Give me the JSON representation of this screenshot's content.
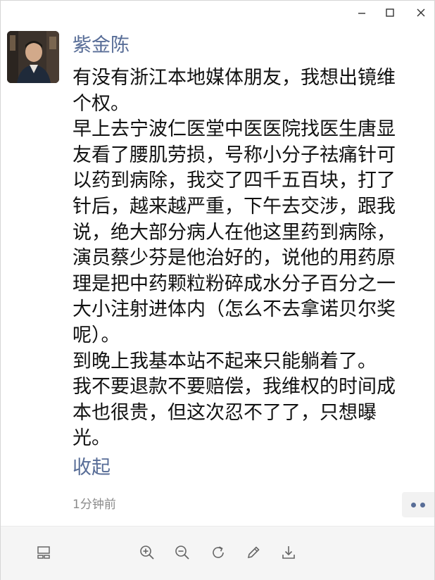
{
  "window": {
    "controls": [
      "minimize-icon",
      "maximize-icon",
      "close-icon"
    ]
  },
  "post": {
    "author": "紫金陈",
    "lines": [
      "有没有浙江本地媒体朋友，我想出镜维",
      "个权。",
      "早上去宁波仁医堂中医医院找医生唐显",
      "友看了腰肌劳损，号称小分子祛痛针可",
      "以药到病除，我交了四千五百块，打了",
      "针后，越来越严重，下午去交涉，跟我",
      "说，绝大部分病人在他这里药到病除，",
      "演员蔡少芬是他治好的，说他的用药原",
      "理是把中药颗粒粉碎成水分子百分之一",
      "大小注射进体内（怎么不去拿诺贝尔奖",
      "呢）。",
      "到晚上我基本站不起来只能躺着了。",
      "我不要退款不要赔偿，我维权的时间成",
      "本也很贵，但这次忍不了了，只想曝",
      "光。"
    ],
    "collapse_label": "收起",
    "timestamp": "1分钟前"
  },
  "toolbar": {
    "tools": [
      "layout-icon",
      "zoom-in-icon",
      "zoom-out-icon",
      "rotate-icon",
      "edit-icon",
      "download-icon"
    ]
  },
  "colors": {
    "link": "#586d97",
    "text": "#111111",
    "muted": "#8a8a8a",
    "toolbar_bg": "#f5f5f5"
  }
}
